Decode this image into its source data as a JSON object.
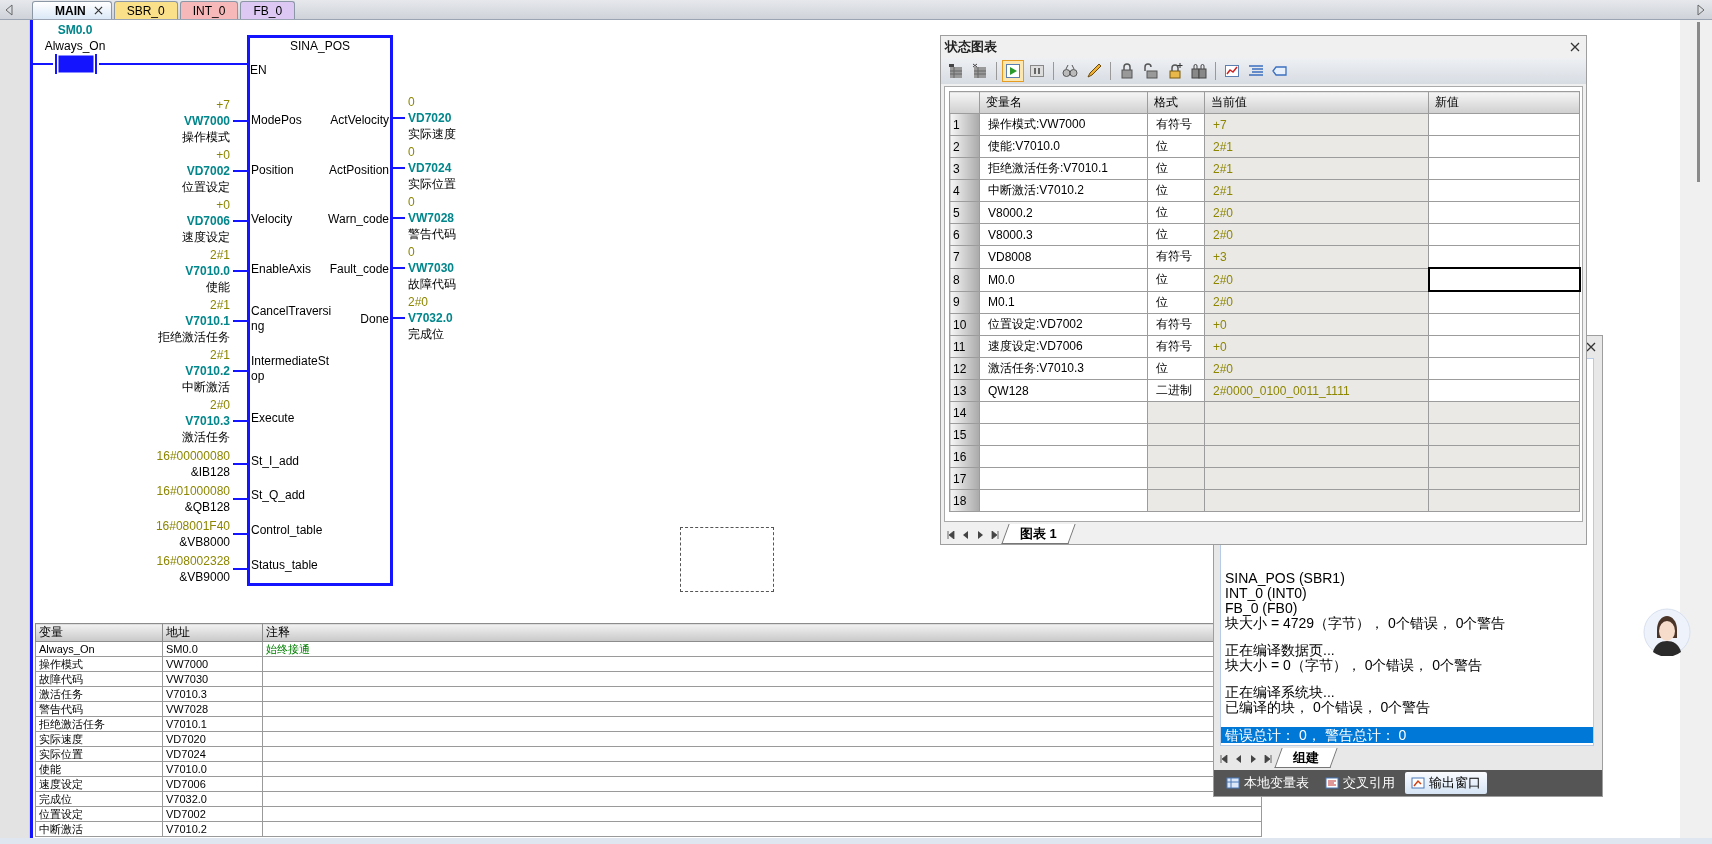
{
  "editor_tabs": [
    {
      "label": "MAIN",
      "selected": true,
      "color": "#dbe8f7"
    },
    {
      "label": "SBR_0",
      "selected": false,
      "color": "#fbe08a"
    },
    {
      "label": "INT_0",
      "selected": false,
      "color": "#f6b8b8"
    },
    {
      "label": "FB_0",
      "selected": false,
      "color": "#dcc8f2"
    }
  ],
  "network": {
    "contact": {
      "address": "SM0.0",
      "symbol": "Always_On",
      "energized": true
    },
    "block": {
      "title": "SINA_POS",
      "enable": "EN",
      "pins": [
        {
          "kind": "variable",
          "input": "ModePos",
          "in_value": "+7",
          "in_address": "VW7000",
          "in_comment": "操作模式",
          "output": "ActVelocity",
          "out_value": "0",
          "out_address": "VD7020",
          "out_comment": "实际速度"
        },
        {
          "kind": "variable",
          "input": "Position",
          "in_value": "+0",
          "in_address": "VD7002",
          "in_comment": "位置设定",
          "output": "ActPosition",
          "out_value": "0",
          "out_address": "VD7024",
          "out_comment": "实际位置"
        },
        {
          "kind": "variable",
          "input": "Velocity",
          "in_value": "+0",
          "in_address": "VD7006",
          "in_comment": "速度设定",
          "output": "Warn_code",
          "out_value": "0",
          "out_address": "VW7028",
          "out_comment": "警告代码"
        },
        {
          "kind": "variable",
          "input": "EnableAxis",
          "in_value": "2#1",
          "in_address": "V7010.0",
          "in_comment": "使能",
          "output": "Fault_code",
          "out_value": "0",
          "out_address": "VW7030",
          "out_comment": "故障代码"
        },
        {
          "kind": "variable",
          "input": "CancelTraversing",
          "in_value": "2#1",
          "in_address": "V7010.1",
          "in_comment": "拒绝激活任务",
          "output": "Done",
          "out_value": "2#0",
          "out_address": "V7032.0",
          "out_comment": "完成位"
        },
        {
          "kind": "variable",
          "input": "IntermediateStop",
          "in_value": "2#1",
          "in_address": "V7010.2",
          "in_comment": "中断激活"
        },
        {
          "kind": "variable",
          "input": "Execute",
          "in_value": "2#0",
          "in_address": "V7010.3",
          "in_comment": "激活任务"
        },
        {
          "kind": "pointer",
          "input": "St_I_add",
          "in_value": "16#00000080",
          "in_address": "&IB128"
        },
        {
          "kind": "pointer",
          "input": "St_Q_add",
          "in_value": "16#01000080",
          "in_address": "&QB128"
        },
        {
          "kind": "pointer",
          "input": "Control_table",
          "in_value": "16#08001F40",
          "in_address": "&VB8000"
        },
        {
          "kind": "pointer",
          "input": "Status_table",
          "in_value": "16#08002328",
          "in_address": "&VB9000"
        }
      ]
    }
  },
  "variable_table": {
    "columns": [
      "变量",
      "地址",
      "注释"
    ],
    "rows": [
      {
        "symbol": "Always_On",
        "address": "SM0.0",
        "comment": "始终接通"
      },
      {
        "symbol": "操作模式",
        "address": "VW7000"
      },
      {
        "symbol": "故障代码",
        "address": "VW7030"
      },
      {
        "symbol": "激活任务",
        "address": "V7010.3"
      },
      {
        "symbol": "警告代码",
        "address": "VW7028"
      },
      {
        "symbol": "拒绝激活任务",
        "address": "V7010.1"
      },
      {
        "symbol": "实际速度",
        "address": "VD7020"
      },
      {
        "symbol": "实际位置",
        "address": "VD7024"
      },
      {
        "symbol": "使能",
        "address": "V7010.0"
      },
      {
        "symbol": "速度设定",
        "address": "VD7006"
      },
      {
        "symbol": "完成位",
        "address": "V7032.0"
      },
      {
        "symbol": "位置设定",
        "address": "VD7002"
      },
      {
        "symbol": "中断激活",
        "address": "V7010.2"
      }
    ]
  },
  "status_chart": {
    "title": "状态图表",
    "toolbar": [
      [
        {
          "kind": "insert-row",
          "pressed": false
        },
        {
          "kind": "delete-row",
          "pressed": false
        }
      ],
      [
        {
          "kind": "run",
          "pressed": true
        },
        {
          "kind": "pause",
          "pressed": false
        }
      ],
      [
        {
          "kind": "glasses",
          "pressed": false
        },
        {
          "kind": "pencil",
          "pressed": false
        }
      ],
      [
        {
          "kind": "lock",
          "pressed": false
        },
        {
          "kind": "unlock",
          "pressed": false
        },
        {
          "kind": "lock-add",
          "pressed": false
        },
        {
          "kind": "lock-all",
          "pressed": false
        }
      ],
      [
        {
          "kind": "trend",
          "pressed": false
        },
        {
          "kind": "list",
          "pressed": false
        },
        {
          "kind": "tag",
          "pressed": false
        }
      ]
    ],
    "columns": [
      "变量名",
      "格式",
      "当前值",
      "新值"
    ],
    "rows": [
      {
        "number": "1",
        "name": "操作模式:VW7000",
        "format": "有符号",
        "value": "+7",
        "selected": false
      },
      {
        "number": "2",
        "name": "使能:V7010.0",
        "format": "位",
        "value": "2#1",
        "selected": false
      },
      {
        "number": "3",
        "name": "拒绝激活任务:V7010.1",
        "format": "位",
        "value": "2#1",
        "selected": false
      },
      {
        "number": "4",
        "name": "中断激活:V7010.2",
        "format": "位",
        "value": "2#1",
        "selected": false
      },
      {
        "number": "5",
        "name": "V8000.2",
        "format": "位",
        "value": "2#0",
        "selected": false
      },
      {
        "number": "6",
        "name": "V8000.3",
        "format": "位",
        "value": "2#0",
        "selected": false
      },
      {
        "number": "7",
        "name": "VD8008",
        "format": "有符号",
        "value": "+3",
        "selected": false
      },
      {
        "number": "8",
        "name": "M0.0",
        "format": "位",
        "value": "2#0",
        "selected": true
      },
      {
        "number": "9",
        "name": "M0.1",
        "format": "位",
        "value": "2#0",
        "selected": false
      },
      {
        "number": "10",
        "name": "位置设定:VD7002",
        "format": "有符号",
        "value": "+0",
        "selected": false
      },
      {
        "number": "11",
        "name": "速度设定:VD7006",
        "format": "有符号",
        "value": "+0",
        "selected": false
      },
      {
        "number": "12",
        "name": "激活任务:V7010.3",
        "format": "位",
        "value": "2#0",
        "selected": false
      },
      {
        "number": "13",
        "name": "QW128",
        "format": "二进制",
        "value": "2#0000_0100_0011_1111",
        "selected": false
      },
      {
        "number": "14",
        "selected": false
      },
      {
        "number": "15",
        "selected": false
      },
      {
        "number": "16",
        "selected": false
      },
      {
        "number": "17",
        "selected": false
      },
      {
        "number": "18",
        "selected": false
      }
    ],
    "sheet_tab": "图表 1"
  },
  "output_window": {
    "message_groups": [
      [
        "SINA_POS (SBR1)",
        "INT_0 (INT0)",
        "FB_0 (FB0)",
        "块大小 = 4729（字节）， 0个错误， 0个警告"
      ],
      [
        "正在编译数据页...",
        "块大小 = 0（字节）， 0个错误， 0个警告"
      ],
      [
        "正在编译系统块...",
        "已编译的块， 0个错误， 0个警告"
      ]
    ],
    "summary": {
      "text": "错误总计： 0， 警告总计： 0",
      "selected": true
    },
    "sheet_tab": "组建",
    "panel_tabs": [
      {
        "kind": "variables",
        "label": "本地变量表",
        "selected": false
      },
      {
        "kind": "cross-reference",
        "label": "交叉引用",
        "selected": false
      },
      {
        "kind": "output",
        "label": "输出窗口",
        "selected": true
      }
    ]
  }
}
